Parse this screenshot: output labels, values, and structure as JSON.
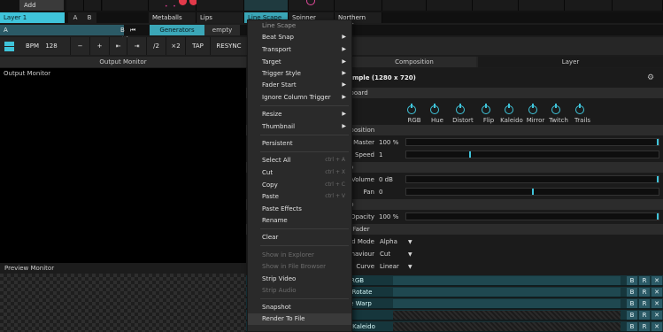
{
  "accent_color": "#3fc4da",
  "top_row": {
    "add_label": "Add"
  },
  "layer_row": {
    "layer_name": "Layer 1",
    "a_label": "A",
    "b_label": "B",
    "clips": [
      "Metaballs",
      "Lips",
      "Line Scape",
      "Spinner",
      "Northern Light"
    ]
  },
  "deck_row": {
    "deck_a": "A",
    "deck_b": "B",
    "skip_back_icon": "skip-back-icon",
    "skip_forward_icon": "skip-forward-icon",
    "tabs": [
      "Generators",
      "empty"
    ]
  },
  "transport": {
    "bpm_label": "BPM",
    "bpm_value": "128",
    "minus": "−",
    "plus": "+",
    "nudge_back": "⇤",
    "nudge_fwd": "⇥",
    "half": "/2",
    "double": "×2",
    "tap": "TAP",
    "resync": "RESYNC"
  },
  "header": {
    "output_monitor": "Output Monitor",
    "composition": "Composition",
    "layer": "Layer"
  },
  "output_monitor": {
    "title": "Output Monitor"
  },
  "preview_monitor": {
    "title": "Preview Monitor"
  },
  "right_panel": {
    "title_partial": "mple (1280 x 720)",
    "settings_icon": "gear-icon",
    "section_dashboard": "hboard",
    "effects": [
      "RGB",
      "Hue",
      "Distort",
      "Flip",
      "Kaleido",
      "Mirror",
      "Twitch",
      "Trails"
    ],
    "section_composition": "nposition",
    "master_label": "Master",
    "master_value": "100 %",
    "master_level": 1.0,
    "speed_label": "Speed",
    "speed_value": "1",
    "speed_level": 0.25,
    "section_audio": "lio",
    "volume_label": "Volume",
    "volume_value": "0 dB",
    "volume_level": 1.0,
    "pan_label": "Pan",
    "pan_value": "0",
    "pan_level": 0.5,
    "section_video": "eo",
    "opacity_label": "Opacity",
    "opacity_value": "100 %",
    "opacity_level": 1.0,
    "section_crossfader": "ssFader",
    "blend_label": "d Mode",
    "blend_value": "Alpha",
    "behaviour_label": "haviour",
    "behaviour_value": "Cut",
    "curve_label": "Curve",
    "curve_value": "Linear",
    "effect_rows": [
      {
        "name": "t RGB",
        "b": "B",
        "r": "R",
        "x": "✕"
      },
      {
        "name": "e Rotate",
        "b": "B",
        "r": "R",
        "x": "✕"
      },
      {
        "name": "ve Warp",
        "b": "B",
        "r": "R",
        "x": "✕"
      },
      {
        "name": "",
        "b": "B",
        "r": "R",
        "x": "✕"
      },
      {
        "name": "arKaleido",
        "b": "B",
        "r": "R",
        "x": "✕"
      }
    ]
  },
  "context_menu": {
    "header": "Line Scape",
    "items": [
      {
        "label": "Beat Snap",
        "submenu": "▶"
      },
      {
        "label": "Transport",
        "submenu": "▶"
      },
      {
        "label": "Target",
        "submenu": "▶"
      },
      {
        "label": "Trigger Style",
        "submenu": "▶"
      },
      {
        "label": "Fader Start",
        "submenu": "▶"
      },
      {
        "label": "Ignore Column Trigger",
        "submenu": "▶"
      },
      {
        "label": "Resize",
        "submenu": "▶"
      },
      {
        "label": "Thumbnail",
        "submenu": "▶"
      },
      {
        "label": "Persistent"
      },
      {
        "label": "Select All",
        "shortcut": "ctrl + A"
      },
      {
        "label": "Cut",
        "shortcut": "ctrl + X"
      },
      {
        "label": "Copy",
        "shortcut": "ctrl + C"
      },
      {
        "label": "Paste",
        "shortcut": "ctrl + V"
      },
      {
        "label": "Paste Effects"
      },
      {
        "label": "Rename"
      },
      {
        "label": "Clear"
      },
      {
        "label": "Show in Explorer"
      },
      {
        "label": "Show in File Browser"
      },
      {
        "label": "Strip Video"
      },
      {
        "label": "Strip Audio"
      },
      {
        "label": "Snapshot"
      },
      {
        "label": "Render To File"
      }
    ]
  }
}
